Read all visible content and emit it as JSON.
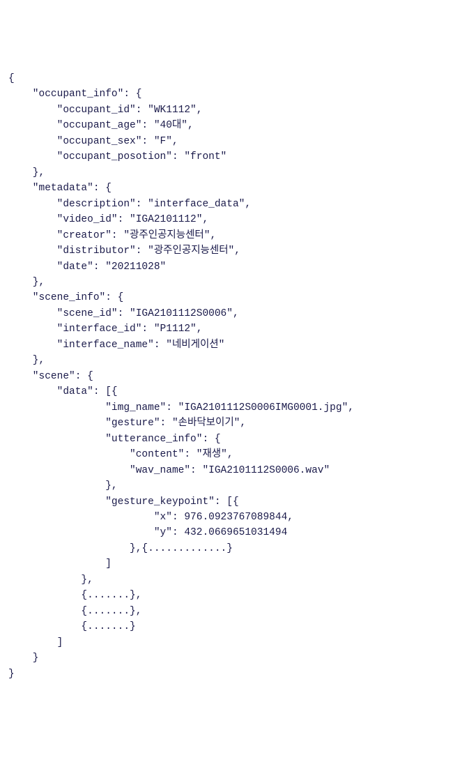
{
  "lines": [
    "{",
    "    \"occupant_info\": {",
    "        \"occupant_id\": \"WK1112\",",
    "        \"occupant_age\": \"40대\",",
    "        \"occupant_sex\": \"F\",",
    "        \"occupant_posotion\": \"front\"",
    "    },",
    "    \"metadata\": {",
    "        \"description\": \"interface_data\",",
    "        \"video_id\": \"IGA2101112\",",
    "        \"creator\": \"광주인공지능센터\",",
    "        \"distributor\": \"광주인공지능센터\",",
    "        \"date\": \"20211028\"",
    "    },",
    "    \"scene_info\": {",
    "        \"scene_id\": \"IGA2101112S0006\",",
    "        \"interface_id\": \"P1112\",",
    "        \"interface_name\": \"네비게이션\"",
    "    },",
    "    \"scene\": {",
    "        \"data\": [{",
    "                \"img_name\": \"IGA2101112S0006IMG0001.jpg\",",
    "                \"gesture\": \"손바닥보이기\",",
    "                \"utterance_info\": {",
    "                    \"content\": \"재생\",",
    "                    \"wav_name\": \"IGA2101112S0006.wav\"",
    "                },",
    "                \"gesture_keypoint\": [{",
    "                        \"x\": 976.0923767089844,",
    "                        \"y\": 432.0669651031494",
    "                    },{.............}",
    "                ]",
    "            },",
    "            {.......},",
    "            {.......},",
    "            {.......}",
    "        ]",
    "    }",
    "}"
  ]
}
